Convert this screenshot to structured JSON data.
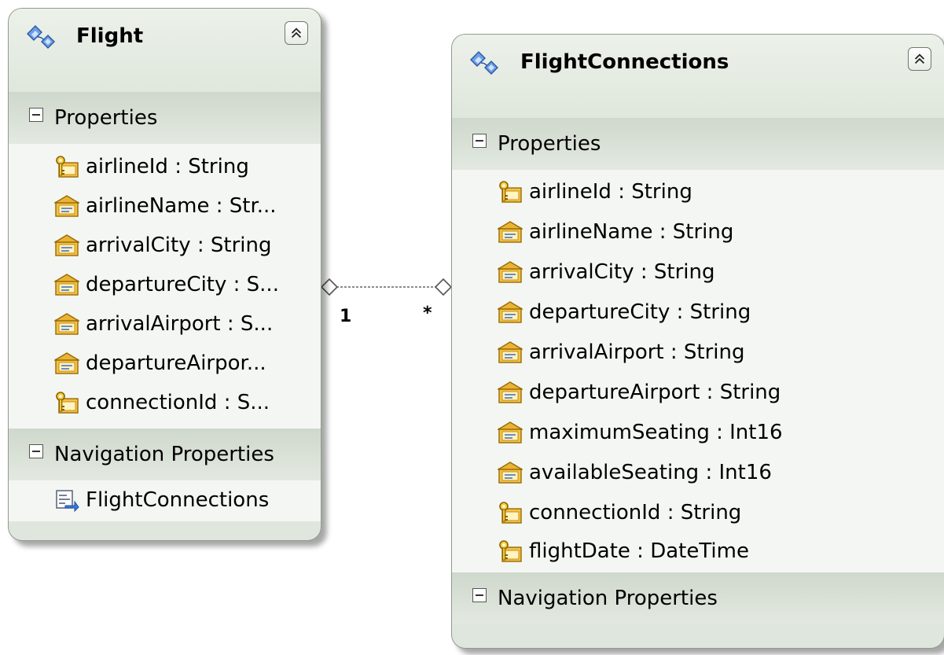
{
  "entities": {
    "flight": {
      "title": "Flight",
      "properties_header": "Properties",
      "properties": [
        {
          "text": "airlineId : String",
          "key": true
        },
        {
          "text": "airlineName  :  Str...",
          "key": false
        },
        {
          "text": "arrivalCity : String",
          "key": false
        },
        {
          "text": "departureCity  :  S...",
          "key": false
        },
        {
          "text": "arrivalAirport  :  S...",
          "key": false
        },
        {
          "text": "departureAirpor...",
          "key": false
        },
        {
          "text": "connectionId  :  S...",
          "key": true
        }
      ],
      "navigation_header": "Navigation Properties",
      "navigation": [
        "FlightConnections"
      ]
    },
    "flight_connections": {
      "title": "FlightConnections",
      "properties_header": "Properties",
      "properties": [
        {
          "text": "airlineId : String",
          "key": true
        },
        {
          "text": "airlineName : String",
          "key": false
        },
        {
          "text": "arrivalCity : String",
          "key": false
        },
        {
          "text": "departureCity : String",
          "key": false
        },
        {
          "text": "arrivalAirport : String",
          "key": false
        },
        {
          "text": "departureAirport : String",
          "key": false
        },
        {
          "text": "maximumSeating : Int16",
          "key": false
        },
        {
          "text": "availableSeating : Int16",
          "key": false
        },
        {
          "text": "connectionId : String",
          "key": true
        },
        {
          "text": "flightDate : DateTime",
          "key": true
        }
      ],
      "navigation_header": "Navigation Properties"
    }
  },
  "association": {
    "from_multiplicity": "1",
    "to_multiplicity": "*"
  },
  "icons": {
    "entity": "entity-icon",
    "key_property": "key-property-icon",
    "property": "property-icon",
    "navigation": "navigation-property-icon",
    "collapse": "collapse-chevron-icon"
  },
  "colors": {
    "entity_fill": "#dfe6dd",
    "entity_border": "#8f9c8c",
    "section_header": "#cfd8cc",
    "section_body": "#f4f6f3"
  }
}
